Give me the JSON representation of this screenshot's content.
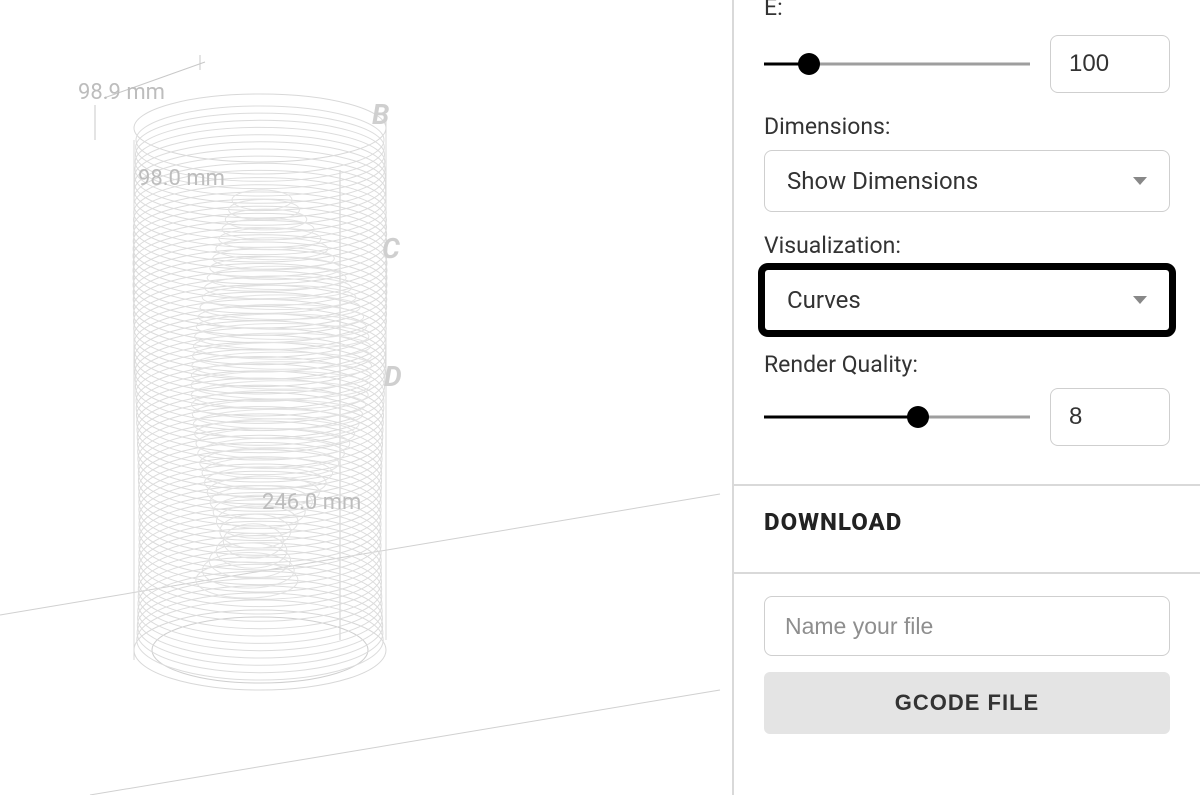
{
  "viewport": {
    "dim_top_width": "98.9 mm",
    "dim_inner_width": "98.0 mm",
    "dim_height": "246.0 mm",
    "edge_letters": [
      "B",
      "C",
      "D"
    ]
  },
  "settings": {
    "e_label": "E:",
    "e_value": "100",
    "e_slider_pct": 17,
    "dimensions_label": "Dimensions:",
    "dimensions_selected": "Show Dimensions",
    "visualization_label": "Visualization:",
    "visualization_selected": "Curves",
    "render_quality_label": "Render Quality:",
    "render_quality_value": "8",
    "render_quality_pct": 58
  },
  "download": {
    "heading": "DOWNLOAD",
    "filename_placeholder": "Name your file",
    "gcode_button": "GCODE FILE"
  }
}
